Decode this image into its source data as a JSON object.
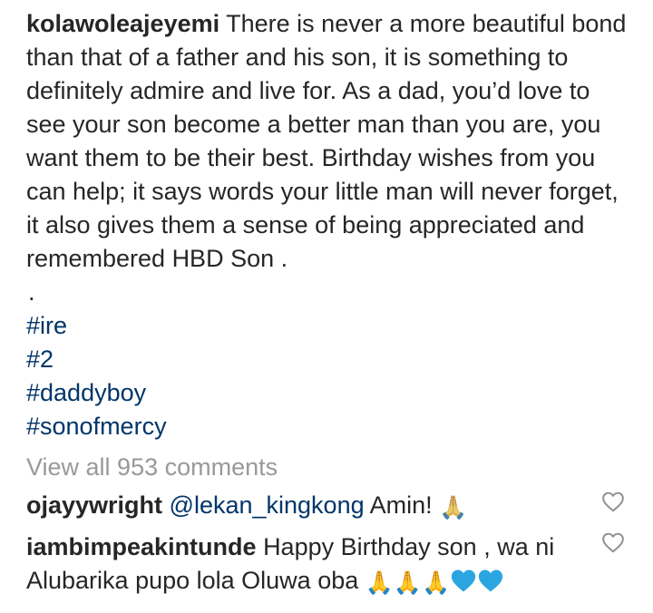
{
  "post": {
    "username": "kolawoleajeyemi",
    "caption": "There is never a more beautiful bond than that of a father and his son, it is something to definitely admire and live for. As a dad, you’d love to see your son become a better man than you are, you want them to be their best. Birthday wishes from you can help; it says words your little man will never forget, it also gives them a sense of being appreciated and remembered HBD Son .",
    "separator": ".",
    "hashtags": [
      "#ire",
      "#2",
      "#daddyboy",
      "#sonofmercy"
    ]
  },
  "comments_link": {
    "label": "View all 953 comments"
  },
  "comments": [
    {
      "username": "ojayywright",
      "mention": "@lekan_kingkong",
      "text": "Amin!",
      "emoji": "🙏",
      "like_icon": "heart-outline-icon"
    },
    {
      "username": "iambimpeakintunde",
      "text": "Happy Birthday son , wa ni Alubarika pupo lola Oluwa oba",
      "emojis": [
        "🙏",
        "🙏",
        "🙏"
      ],
      "heart_icons": [
        "blue-heart-icon",
        "blue-heart-icon"
      ],
      "like_icon": "heart-outline-icon"
    }
  ],
  "colors": {
    "text": "#262626",
    "link": "#003569",
    "muted": "#999999",
    "blue_heart": "#2aa5e0"
  }
}
